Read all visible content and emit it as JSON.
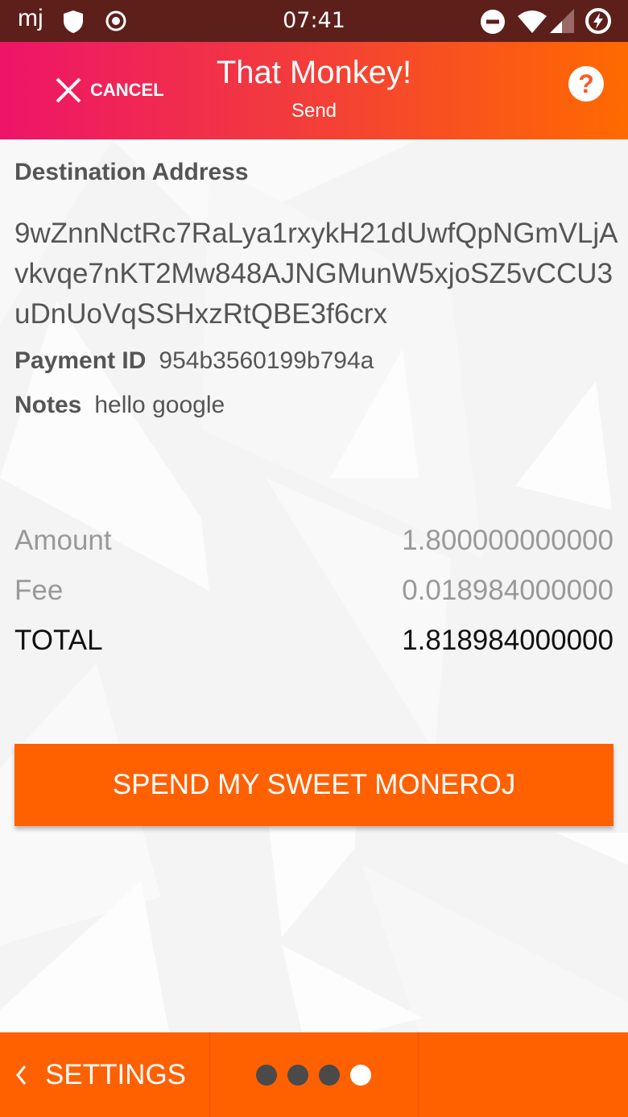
{
  "status_bar": {
    "time": "07:41",
    "left_icons": [
      "mj-app-icon",
      "shield-icon",
      "record-icon"
    ],
    "right_icons": [
      "do-not-disturb-icon",
      "wifi-icon",
      "cell-signal-icon",
      "battery-charging-icon"
    ]
  },
  "app_bar": {
    "cancel_label": "CANCEL",
    "title": "That Monkey!",
    "subtitle": "Send",
    "help_icon": "?"
  },
  "details": {
    "destination_label": "Destination Address",
    "destination_address": "9wZnnNctRc7RaLya1rxykH21dUwfQpNGmVLjAvkvqe7nKT2Mw848AJNGMunW5xjoSZ5vCCU3uDnUoVqSSHxzRtQBE3f6crx",
    "payment_id_label": "Payment ID",
    "payment_id": "954b3560199b794a",
    "notes_label": "Notes",
    "notes": "hello google"
  },
  "amounts": {
    "amount_label": "Amount",
    "amount_value": "1.800000000000",
    "fee_label": "Fee",
    "fee_value": "0.018984000000",
    "total_label": "TOTAL",
    "total_value": "1.818984000000"
  },
  "spend_button_label": "SPEND MY SWEET MONEROJ",
  "bottom_bar": {
    "back_label": "SETTINGS",
    "page_count": 4,
    "active_page": 4
  },
  "colors": {
    "status_bar": "#5d1f1a",
    "accent": "#ff6000",
    "gradient_start": "#ee1468",
    "gradient_end": "#ff6a00"
  }
}
